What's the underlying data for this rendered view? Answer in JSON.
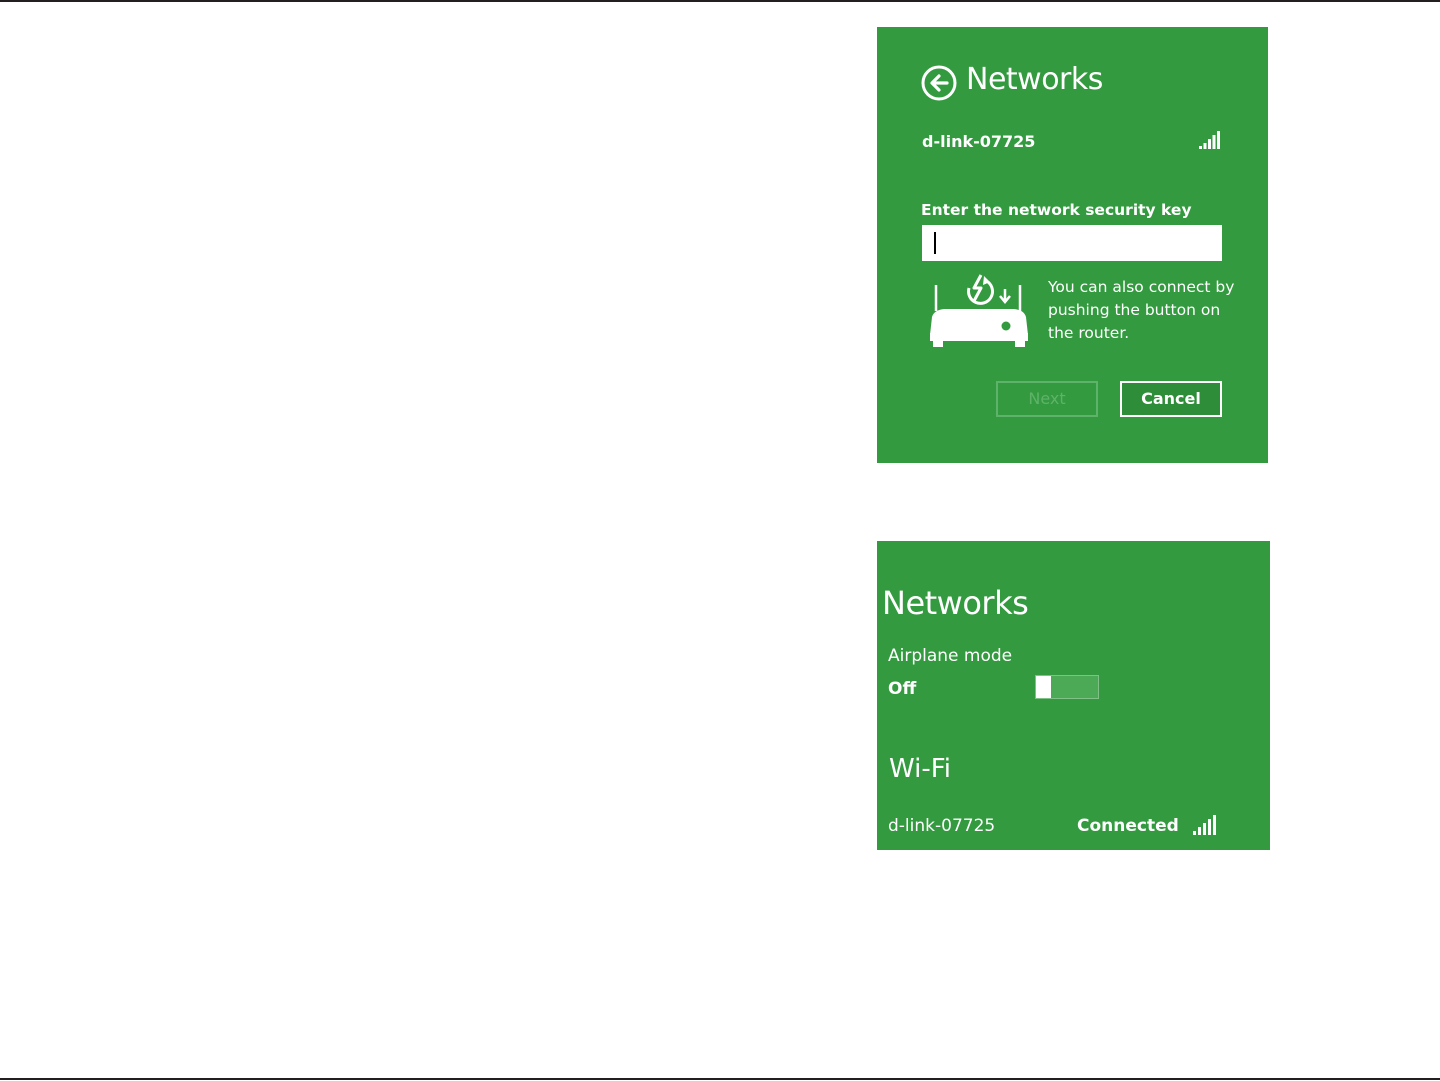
{
  "connect_dialog": {
    "title": "Networks",
    "network_name": "d-link-07725",
    "key_label": "Enter the network security key",
    "key_value": "",
    "wps_hint": "You can also connect by pushing the button on the router.",
    "next_label": "Next",
    "cancel_label": "Cancel",
    "icons": [
      "back-arrow-circle-icon",
      "signal-strength-icon",
      "router-wps-icon"
    ]
  },
  "networks_panel": {
    "title": "Networks",
    "airplane_mode_label": "Airplane mode",
    "airplane_mode_state": "Off",
    "airplane_mode_on": false,
    "wifi_heading": "Wi-Fi",
    "network_name": "d-link-07725",
    "network_status": "Connected",
    "icons": [
      "signal-strength-icon"
    ]
  },
  "colors": {
    "panel_green": "#339a3f",
    "text": "#ffffff",
    "disabled_button": "#5fb269",
    "rule": "#231f20"
  }
}
